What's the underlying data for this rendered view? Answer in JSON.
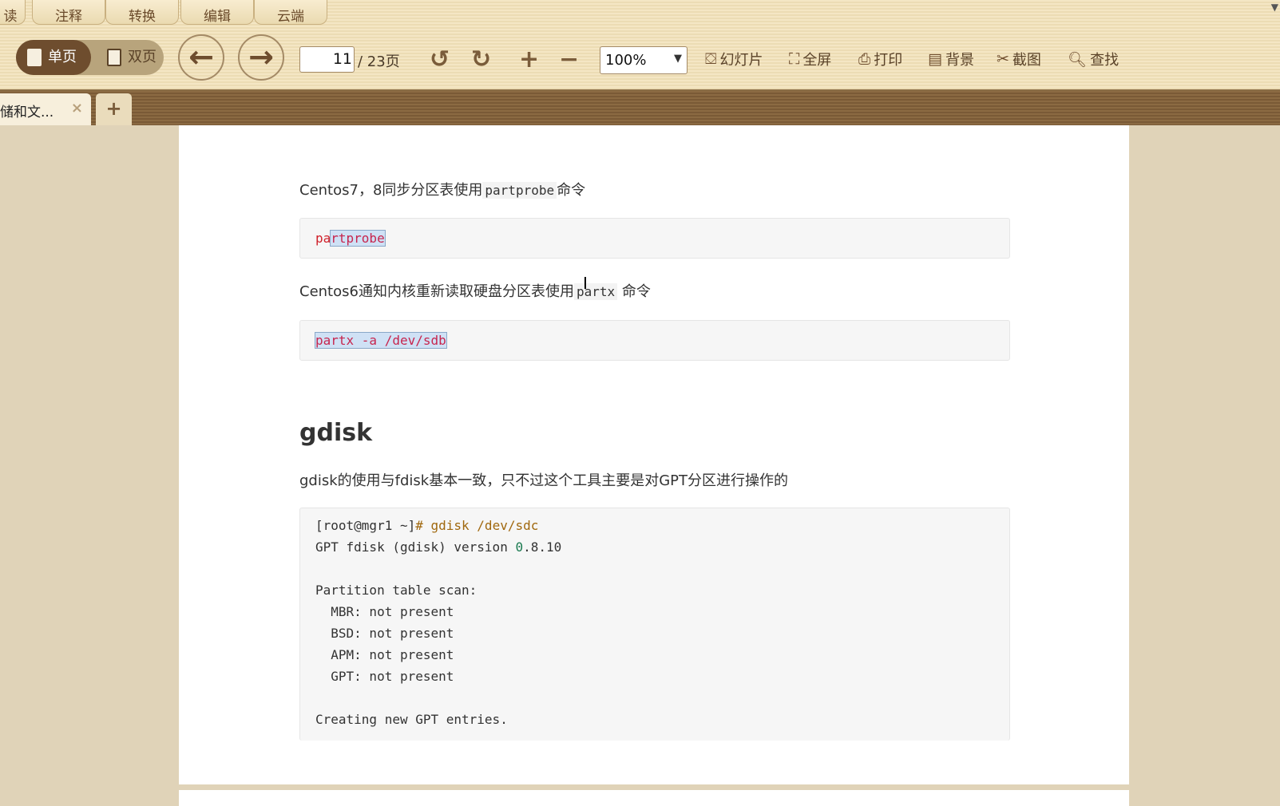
{
  "menu_tabs": [
    "读",
    "注释",
    "转换",
    "编辑",
    "云端"
  ],
  "toolbar": {
    "single_page": "单页",
    "double_page": "双页",
    "page_current": "11",
    "page_total": "/ 23页",
    "zoom": "100%",
    "buttons": [
      {
        "label": "幻灯片",
        "icon": "slideshow-icon"
      },
      {
        "label": "全屏",
        "icon": "fullscreen-icon"
      },
      {
        "label": "打印",
        "icon": "print-icon"
      },
      {
        "label": "背景",
        "icon": "background-icon"
      },
      {
        "label": "截图",
        "icon": "scissors-icon"
      },
      {
        "label": "查找",
        "icon": "search-icon"
      }
    ]
  },
  "doc_tab": {
    "title": "储和文...",
    "close": "×",
    "new": "+"
  },
  "content": {
    "p1_pre": "Centos7，8同步分区表使用",
    "p1_code": "partprobe",
    "p1_post": "命令",
    "code1_a": "pa",
    "code1_b": "rtprobe",
    "p2_pre": "Centos6通知内核重新读取硬盘分区表使用",
    "p2_code": "partx",
    "p2_post": "命令",
    "code2": "partx -a /dev/sdb",
    "heading": "gdisk",
    "p3": "gdisk的使用与fdisk基本一致，只不过这个工具主要是对GPT分区进行操作的",
    "code3": {
      "prompt": "[root@mgr1 ~]",
      "cmd": "# gdisk /dev/sdc",
      "ver_pre": "GPT fdisk (gdisk) version ",
      "ver_num": "0",
      "ver_post": ".8.10",
      "lines": [
        "Partition table scan:",
        "  MBR: not present",
        "  BSD: not present",
        "  APM: not present",
        "  GPT: not present",
        "",
        "Creating new GPT entries."
      ]
    }
  }
}
